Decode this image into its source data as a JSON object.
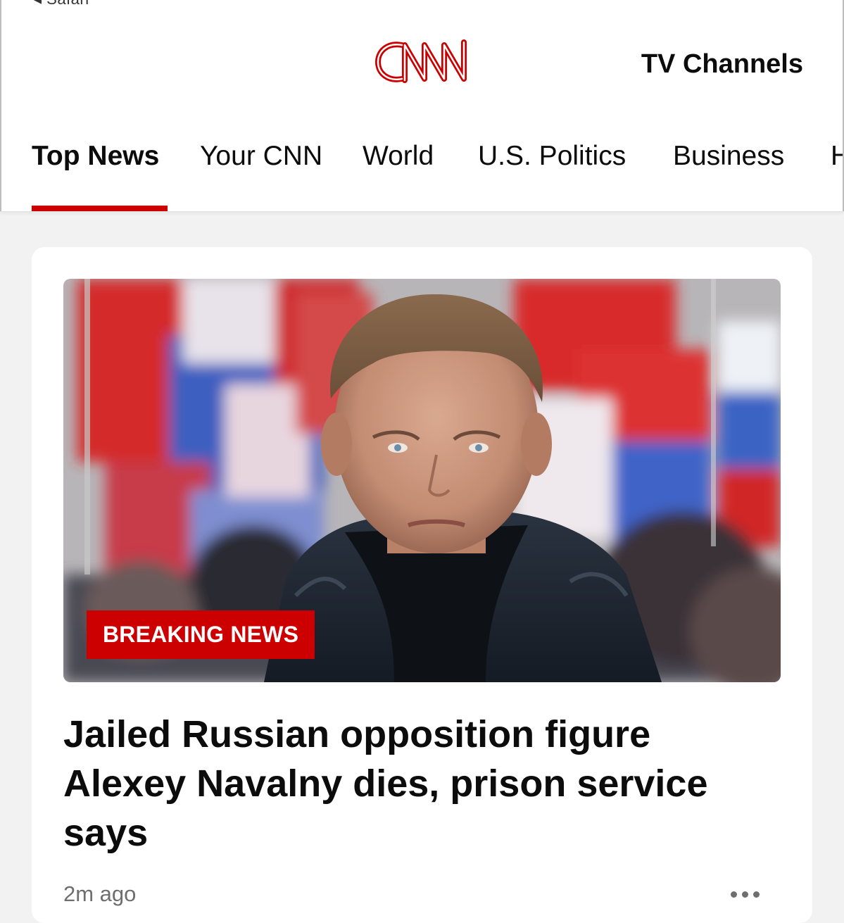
{
  "status_bar": {
    "back_app": "◂ Safari"
  },
  "header": {
    "logo_text": "CNN",
    "tv_channels": "TV Channels"
  },
  "nav": {
    "tabs": [
      {
        "label": "Top News",
        "active": true
      },
      {
        "label": "Your CNN",
        "active": false
      },
      {
        "label": "World",
        "active": false
      },
      {
        "label": "U.S. Politics",
        "active": false
      },
      {
        "label": "Business",
        "active": false
      },
      {
        "label": "H",
        "active": false
      }
    ]
  },
  "article": {
    "badge": "BREAKING NEWS",
    "headline": "Jailed Russian opposition figure Alexey Navalny dies, prison service says",
    "timestamp": "2m ago",
    "image_icon": "news-photo"
  },
  "colors": {
    "brand_red": "#cc0000",
    "text": "#0c0c0c",
    "muted": "#6e6e6e",
    "background": "#f2f2f2"
  }
}
